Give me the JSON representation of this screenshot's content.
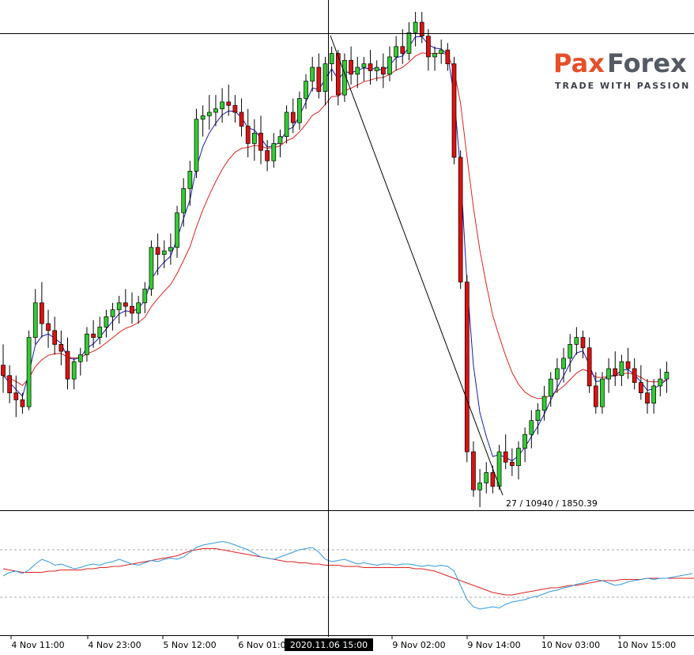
{
  "brand": {
    "name_part1": "Pax",
    "name_part2": "Forex",
    "tagline": "TRADE WITH PASSION"
  },
  "crosshair": {
    "time_label": "2020.11.06 15:00"
  },
  "fibo_label": "27 / 10940 / 1850.39",
  "colors": {
    "bull": "#33cc33",
    "bear": "#dd1111",
    "ma_fast": "#1a1aaa",
    "ma_slow": "#dd2222",
    "osc_main": "#3399dd",
    "osc_signal": "#dd2222"
  },
  "chart_data": {
    "type": "candlestick",
    "x_tick_labels": [
      "4 Nov 11:00",
      "4 Nov 23:00",
      "5 Nov 12:00",
      "6 Nov 01:00",
      "9 Nov 02:00",
      "9 Nov 14:00",
      "10 Nov 03:00",
      "10 Nov 15:00"
    ],
    "y_range": [
      1850,
      1962
    ],
    "candles": [
      [
        1888,
        1894,
        1880,
        1885
      ],
      [
        1885,
        1888,
        1877,
        1880
      ],
      [
        1880,
        1885,
        1873,
        1878
      ],
      [
        1878,
        1880,
        1874,
        1876
      ],
      [
        1876,
        1898,
        1875,
        1896
      ],
      [
        1896,
        1910,
        1894,
        1906
      ],
      [
        1906,
        1912,
        1896,
        1900
      ],
      [
        1900,
        1904,
        1893,
        1898
      ],
      [
        1898,
        1902,
        1891,
        1894
      ],
      [
        1894,
        1898,
        1888,
        1892
      ],
      [
        1892,
        1896,
        1881,
        1884
      ],
      [
        1884,
        1890,
        1881,
        1889
      ],
      [
        1889,
        1893,
        1885,
        1891
      ],
      [
        1891,
        1899,
        1889,
        1897
      ],
      [
        1897,
        1901,
        1893,
        1896
      ],
      [
        1896,
        1902,
        1894,
        1899
      ],
      [
        1899,
        1904,
        1896,
        1902
      ],
      [
        1902,
        1906,
        1898,
        1904
      ],
      [
        1904,
        1908,
        1900,
        1906
      ],
      [
        1906,
        1910,
        1902,
        1905
      ],
      [
        1905,
        1909,
        1900,
        1903
      ],
      [
        1903,
        1908,
        1900,
        1906
      ],
      [
        1906,
        1912,
        1903,
        1910
      ],
      [
        1910,
        1924,
        1908,
        1922
      ],
      [
        1922,
        1926,
        1914,
        1920
      ],
      [
        1920,
        1924,
        1916,
        1921
      ],
      [
        1921,
        1926,
        1917,
        1922
      ],
      [
        1922,
        1934,
        1919,
        1932
      ],
      [
        1932,
        1942,
        1928,
        1939
      ],
      [
        1939,
        1947,
        1934,
        1944
      ],
      [
        1944,
        1962,
        1942,
        1959
      ],
      [
        1959,
        1963,
        1954,
        1960
      ],
      [
        1960,
        1966,
        1956,
        1961
      ],
      [
        1961,
        1966,
        1957,
        1962
      ],
      [
        1962,
        1968,
        1958,
        1964
      ],
      [
        1964,
        1969,
        1960,
        1963
      ],
      [
        1963,
        1966,
        1958,
        1961
      ],
      [
        1961,
        1965,
        1954,
        1957
      ],
      [
        1957,
        1962,
        1948,
        1952
      ],
      [
        1952,
        1959,
        1947,
        1955
      ],
      [
        1955,
        1960,
        1946,
        1950
      ],
      [
        1950,
        1953,
        1944,
        1947
      ],
      [
        1947,
        1955,
        1945,
        1952
      ],
      [
        1952,
        1956,
        1948,
        1954
      ],
      [
        1954,
        1963,
        1952,
        1961
      ],
      [
        1961,
        1965,
        1955,
        1958
      ],
      [
        1958,
        1967,
        1956,
        1965
      ],
      [
        1965,
        1972,
        1962,
        1970
      ],
      [
        1970,
        1977,
        1967,
        1974
      ],
      [
        1974,
        1978,
        1965,
        1967
      ],
      [
        1967,
        1977,
        1963,
        1975
      ],
      [
        1975,
        1980,
        1970,
        1978
      ],
      [
        1978,
        1979,
        1963,
        1966
      ],
      [
        1966,
        1978,
        1964,
        1976
      ],
      [
        1976,
        1980,
        1969,
        1972
      ],
      [
        1972,
        1977,
        1968,
        1974
      ],
      [
        1974,
        1977,
        1970,
        1975
      ],
      [
        1975,
        1979,
        1969,
        1973
      ],
      [
        1973,
        1976,
        1970,
        1974
      ],
      [
        1974,
        1978,
        1968,
        1972
      ],
      [
        1972,
        1980,
        1970,
        1977
      ],
      [
        1977,
        1983,
        1973,
        1980
      ],
      [
        1980,
        1985,
        1975,
        1978
      ],
      [
        1978,
        1987,
        1976,
        1984
      ],
      [
        1984,
        1990,
        1980,
        1987
      ],
      [
        1987,
        1990,
        1981,
        1983
      ],
      [
        1983,
        1985,
        1973,
        1977
      ],
      [
        1977,
        1980,
        1973,
        1978
      ],
      [
        1978,
        1982,
        1975,
        1979
      ],
      [
        1979,
        1981,
        1973,
        1975
      ],
      [
        1975,
        1977,
        1946,
        1948
      ],
      [
        1948,
        1950,
        1910,
        1912
      ],
      [
        1912,
        1914,
        1860,
        1863
      ],
      [
        1863,
        1866,
        1850,
        1852
      ],
      [
        1852,
        1858,
        1847,
        1854
      ],
      [
        1854,
        1860,
        1851,
        1857
      ],
      [
        1857,
        1859,
        1851,
        1853
      ],
      [
        1853,
        1865,
        1852,
        1863
      ],
      [
        1863,
        1868,
        1858,
        1860
      ],
      [
        1860,
        1864,
        1856,
        1859
      ],
      [
        1859,
        1866,
        1855,
        1864
      ],
      [
        1864,
        1870,
        1860,
        1868
      ],
      [
        1868,
        1875,
        1864,
        1872
      ],
      [
        1872,
        1877,
        1868,
        1875
      ],
      [
        1875,
        1882,
        1872,
        1879
      ],
      [
        1879,
        1886,
        1876,
        1884
      ],
      [
        1884,
        1890,
        1880,
        1887
      ],
      [
        1887,
        1893,
        1883,
        1890
      ],
      [
        1890,
        1897,
        1886,
        1894
      ],
      [
        1894,
        1899,
        1891,
        1896
      ],
      [
        1896,
        1898,
        1890,
        1893
      ],
      [
        1893,
        1896,
        1880,
        1882
      ],
      [
        1882,
        1886,
        1874,
        1876
      ],
      [
        1876,
        1886,
        1874,
        1884
      ],
      [
        1884,
        1890,
        1880,
        1887
      ],
      [
        1887,
        1892,
        1882,
        1885
      ],
      [
        1885,
        1891,
        1882,
        1889
      ],
      [
        1889,
        1893,
        1884,
        1887
      ],
      [
        1887,
        1890,
        1881,
        1883
      ],
      [
        1883,
        1888,
        1878,
        1880
      ],
      [
        1880,
        1884,
        1874,
        1877
      ],
      [
        1877,
        1884,
        1874,
        1882
      ],
      [
        1882,
        1887,
        1879,
        1884
      ],
      [
        1884,
        1889,
        1880,
        1886
      ]
    ],
    "oscillator": {
      "main": [
        48,
        51,
        52,
        50,
        53,
        58,
        62,
        60,
        57,
        58,
        56,
        54,
        55,
        57,
        58,
        57,
        59,
        60,
        62,
        60,
        58,
        57,
        59,
        61,
        60,
        62,
        63,
        62,
        64,
        68,
        72,
        74,
        75,
        76,
        77,
        76,
        74,
        72,
        70,
        67,
        64,
        63,
        62,
        64,
        66,
        68,
        70,
        71,
        72,
        68,
        62,
        60,
        61,
        62,
        60,
        58,
        59,
        58,
        57,
        58,
        58,
        57,
        58,
        58,
        57,
        56,
        57,
        56,
        57,
        56,
        52,
        40,
        28,
        22,
        20,
        21,
        22,
        21,
        24,
        26,
        27,
        28,
        30,
        31,
        33,
        35,
        36,
        38,
        39,
        41,
        42,
        44,
        45,
        44,
        42,
        40,
        41,
        43,
        44,
        45,
        46,
        45,
        46,
        46,
        47,
        48,
        49,
        50
      ],
      "signal": [
        54,
        53,
        52,
        51,
        51,
        51,
        51,
        52,
        52,
        53,
        53,
        53,
        53,
        54,
        54,
        55,
        55,
        56,
        56,
        57,
        58,
        59,
        60,
        61,
        62,
        63,
        64,
        65,
        67,
        69,
        70,
        71,
        71,
        71,
        70,
        69,
        68,
        67,
        66,
        65,
        64,
        63,
        62,
        61,
        60,
        60,
        59,
        59,
        58,
        58,
        57,
        57,
        57,
        56,
        56,
        56,
        55,
        55,
        55,
        55,
        55,
        55,
        55,
        55,
        54,
        54,
        53,
        52,
        50,
        48,
        46,
        44,
        42,
        40,
        38,
        36,
        34,
        33,
        32,
        32,
        33,
        34,
        35,
        36,
        37,
        38,
        38,
        39,
        40,
        40,
        41,
        42,
        43,
        44,
        44,
        44,
        45,
        45,
        45,
        45,
        46,
        46,
        46,
        46,
        46,
        46,
        46,
        46,
        46,
        47
      ]
    },
    "oscillator_levels": [
      70,
      30
    ]
  }
}
